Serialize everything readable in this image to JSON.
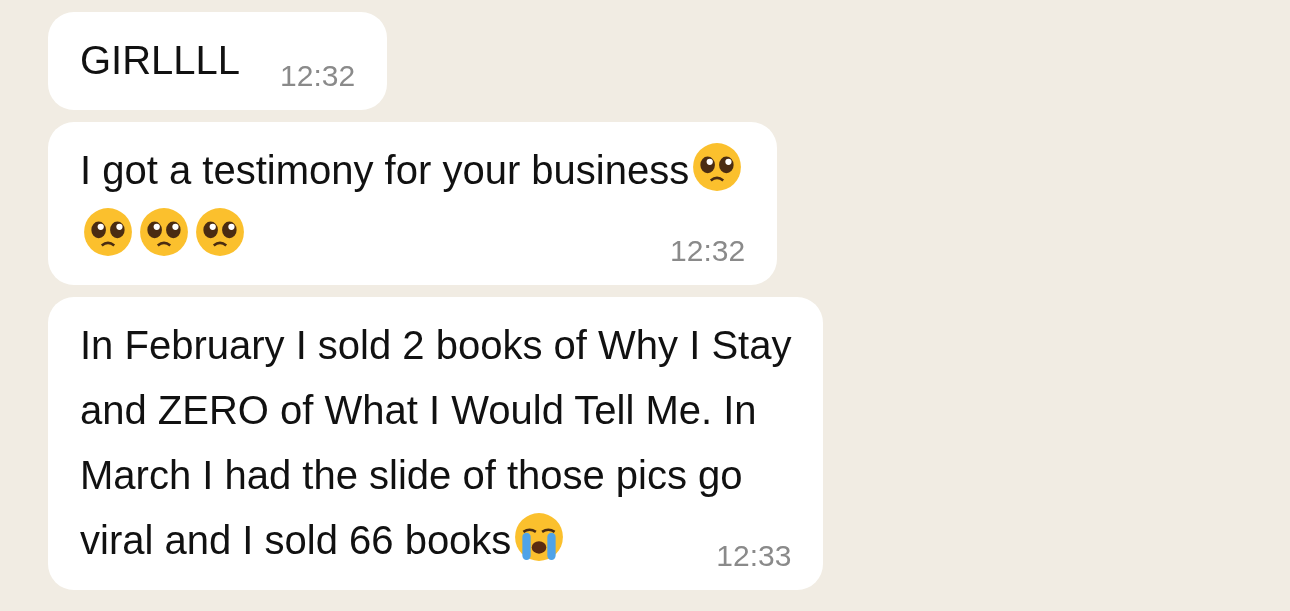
{
  "messages": [
    {
      "segments": [
        {
          "kind": "text",
          "text": "GIRLLLL"
        }
      ],
      "time": "12:32"
    },
    {
      "segments": [
        {
          "kind": "text",
          "text": "I got a testimony for your business"
        },
        {
          "kind": "pleading"
        },
        {
          "kind": "break"
        },
        {
          "kind": "pleading"
        },
        {
          "kind": "pleading"
        },
        {
          "kind": "pleading"
        }
      ],
      "time": "12:32"
    },
    {
      "segments": [
        {
          "kind": "text",
          "text": "In February I sold 2 books of Why I Stay"
        },
        {
          "kind": "break"
        },
        {
          "kind": "text",
          "text": "and ZERO of What I Would Tell Me. In"
        },
        {
          "kind": "break"
        },
        {
          "kind": "text",
          "text": "March I had the slide of those pics go"
        },
        {
          "kind": "break"
        },
        {
          "kind": "text",
          "text": "viral and I sold 66 books"
        },
        {
          "kind": "crying"
        }
      ],
      "time": "12:33"
    }
  ]
}
